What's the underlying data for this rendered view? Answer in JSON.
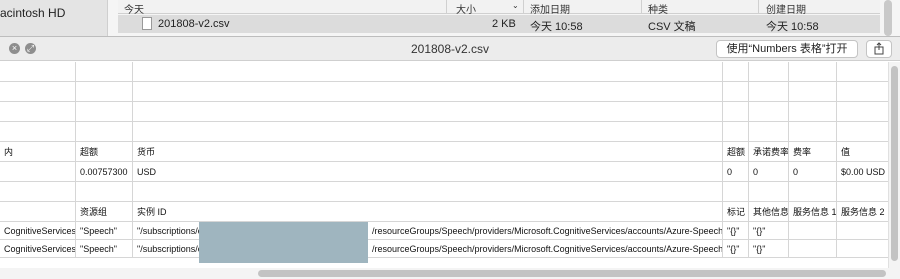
{
  "finder": {
    "sidebar_disk": "acintosh HD",
    "columns": {
      "name": "今天",
      "size": "大小",
      "added": "添加日期",
      "kind": "种类",
      "created": "创建日期"
    },
    "file": {
      "name": "201808-v2.csv",
      "size": "2 KB",
      "added": "今天 10:58",
      "kind": "CSV 文稿",
      "created": "今天 10:58"
    }
  },
  "quicklook": {
    "title": "201808-v2.csv",
    "open_button": "使用“Numbers 表格”打开",
    "close_icon": "close-icon",
    "fullscreen_icon": "fullscreen-icon",
    "share_icon": "share-icon"
  },
  "sheet": {
    "rows": [
      [
        "",
        "",
        "",
        "",
        "",
        "",
        "",
        ""
      ],
      [
        "",
        "",
        "",
        "",
        "",
        "",
        "",
        ""
      ],
      [
        "",
        "",
        "",
        "",
        "",
        "",
        "",
        ""
      ],
      [
        "",
        "",
        "",
        "",
        "",
        "",
        "",
        ""
      ],
      [
        "内",
        "超额",
        "货币",
        "",
        "超额",
        "承诺费率",
        "费率",
        "值"
      ],
      [
        "",
        "0.00757300",
        "USD",
        "",
        "0",
        "0",
        "0",
        "$0.00 USD"
      ],
      [
        "",
        "",
        "",
        "",
        "",
        "",
        "",
        ""
      ],
      [
        "",
        "资源组",
        "实例 ID",
        "",
        "标记",
        "其他信息",
        "服务信息 1",
        "服务信息 2"
      ],
      [
        "CognitiveServices\"",
        "\"Speech\"",
        "\"/subscriptions/c",
        "/resourceGroups/Speech/providers/Microsoft.CognitiveServices/accounts/Azure-Speech\"",
        "\"{}\"",
        "\"{}\"",
        "",
        ""
      ],
      [
        "CognitiveServices\"",
        "\"Speech\"",
        "\"/subscriptions/c",
        "/resourceGroups/Speech/providers/Microsoft.CognitiveServices/accounts/Azure-Speech\"",
        "\"{}\"",
        "\"{}\"",
        "",
        ""
      ]
    ]
  }
}
